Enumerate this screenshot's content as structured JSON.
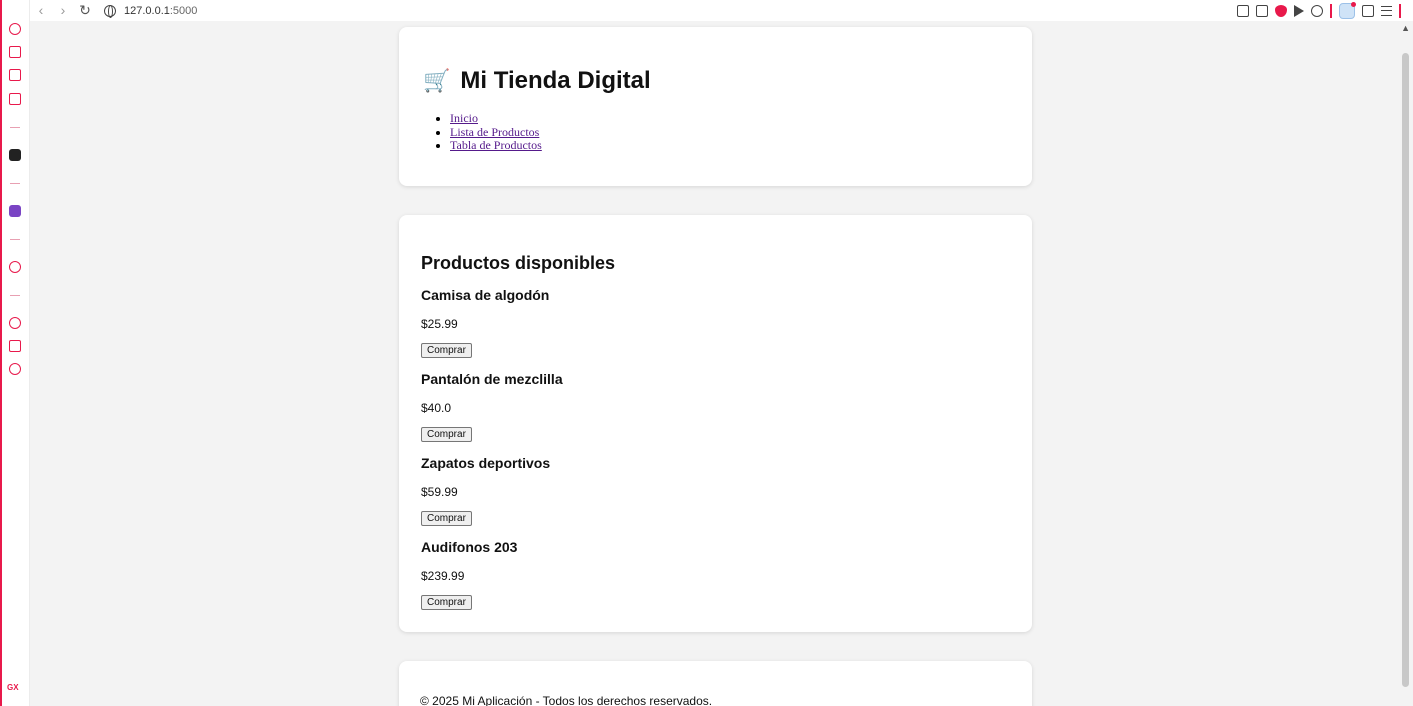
{
  "browser": {
    "url_host": "127.0.0.1",
    "url_port": ":5000"
  },
  "site": {
    "cart_icon": "🛒",
    "title": "Mi Tienda Digital",
    "nav": [
      "Inicio",
      "Lista de Productos",
      "Tabla de Productos"
    ]
  },
  "products_section": {
    "title": "Productos disponibles",
    "items": [
      {
        "name": "Camisa de algodón",
        "price": "$25.99",
        "button": "Comprar"
      },
      {
        "name": "Pantalón de mezclilla",
        "price": "$40.0",
        "button": "Comprar"
      },
      {
        "name": "Zapatos deportivos",
        "price": "$59.99",
        "button": "Comprar"
      },
      {
        "name": "Audifonos 203",
        "price": "$239.99",
        "button": "Comprar"
      }
    ]
  },
  "footer": {
    "text": "© 2025 Mi Aplicación - Todos los derechos reservados."
  },
  "sidebar": {
    "logo_text": "GX"
  },
  "colors": {
    "accent": "#e8194b",
    "link_visited": "#551a8b",
    "page_bg": "#f3f3f3"
  }
}
